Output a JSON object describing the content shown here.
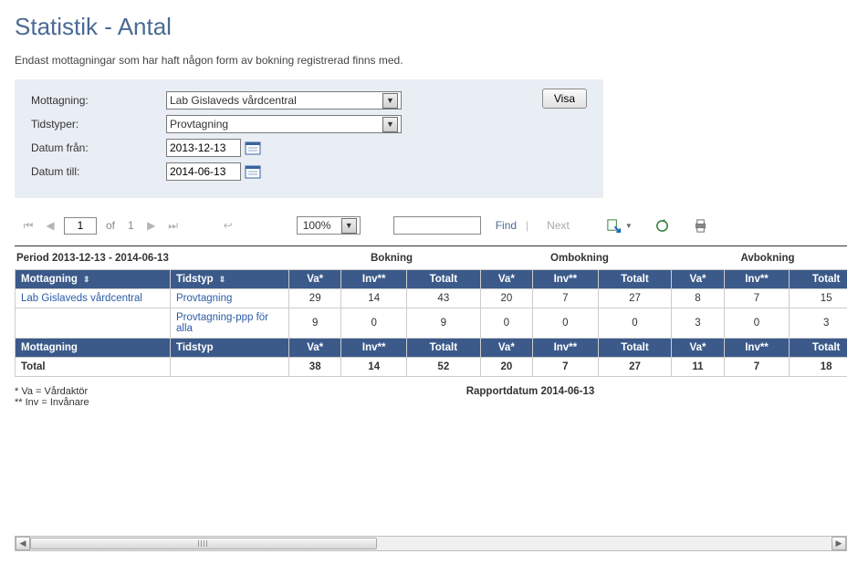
{
  "page": {
    "title": "Statistik - Antal",
    "subtitle": "Endast mottagningar som har haft någon form av bokning registrerad finns med."
  },
  "filters": {
    "mottagning_label": "Mottagning:",
    "mottagning_value": "Lab Gislaveds vårdcentral",
    "tidstyper_label": "Tidstyper:",
    "tidstyper_value": "Provtagning",
    "datum_fran_label": "Datum från:",
    "datum_fran_value": "2013-12-13",
    "datum_till_label": "Datum till:",
    "datum_till_value": "2014-06-13",
    "visa_label": "Visa"
  },
  "toolbar": {
    "page_current": "1",
    "of_label": "of",
    "page_total": "1",
    "zoom": "100%",
    "find_label": "Find",
    "next_label": "Next"
  },
  "report": {
    "period_label": "Period 2013-12-13  -  2014-06-13",
    "groups": {
      "g1": "Bokning",
      "g2": "Ombokning",
      "g3": "Avbokning"
    },
    "head": {
      "mottagning": "Mottagning",
      "tidstyp": "Tidstyp",
      "va": "Va*",
      "inv": "Inv**",
      "totalt": "Totalt"
    },
    "rows": [
      {
        "mottagning": "Lab Gislaveds vårdcentral",
        "tidstyp": "Provtagning",
        "g1": {
          "va": "29",
          "inv": "14",
          "tot": "43"
        },
        "g2": {
          "va": "20",
          "inv": "7",
          "tot": "27"
        },
        "g3": {
          "va": "8",
          "inv": "7",
          "tot": "15"
        }
      },
      {
        "mottagning": "",
        "tidstyp": "Provtagning-ppp för alla",
        "g1": {
          "va": "9",
          "inv": "0",
          "tot": "9"
        },
        "g2": {
          "va": "0",
          "inv": "0",
          "tot": "0"
        },
        "g3": {
          "va": "3",
          "inv": "0",
          "tot": "3"
        }
      }
    ],
    "total_label": "Total",
    "totals": {
      "g1": {
        "va": "38",
        "inv": "14",
        "tot": "52"
      },
      "g2": {
        "va": "20",
        "inv": "7",
        "tot": "27"
      },
      "g3": {
        "va": "11",
        "inv": "7",
        "tot": "18"
      }
    },
    "footnote1": "*   Va = Vårdaktör",
    "footnote2": "**  Inv = Invånare",
    "report_date": "Rapportdatum 2014-06-13"
  }
}
